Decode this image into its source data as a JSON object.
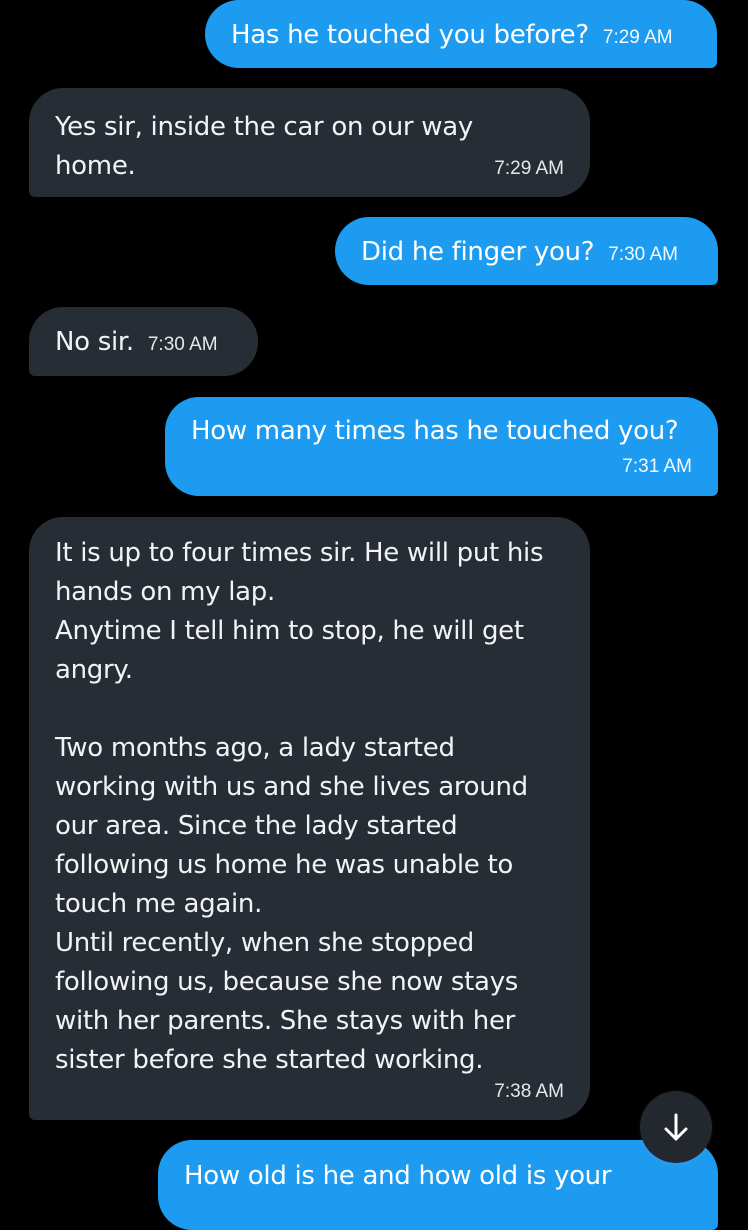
{
  "messages": [
    {
      "side": "sent",
      "text": "Has he touched you before?",
      "time": "7:29 AM"
    },
    {
      "side": "received",
      "lines": [
        "Yes sir, inside the car on our way",
        "home."
      ],
      "time": "7:29 AM"
    },
    {
      "side": "sent",
      "text": "Did he finger you?",
      "time": "7:30 AM"
    },
    {
      "side": "received",
      "text": "No sir.",
      "time": "7:30 AM"
    },
    {
      "side": "sent",
      "text": "How many times has he touched you?",
      "time": "7:31 AM"
    },
    {
      "side": "received",
      "lines": [
        "It is up to four times sir. He will put his",
        "hands on my lap.",
        "Anytime I tell him to stop, he will get",
        "angry.",
        "",
        "Two months ago, a lady started",
        "working with us and she lives around",
        "our area. Since the lady started",
        "following us home he was unable to",
        "touch me again.",
        "Until recently, when she stopped",
        "following us, because she now stays",
        "with her parents. She stays with her",
        "sister before she started working."
      ],
      "time": "7:38 AM"
    },
    {
      "side": "sent",
      "text": "How old is he and how old is your",
      "time": ""
    }
  ],
  "scroll_button": {
    "icon": "arrow-down-icon"
  },
  "colors": {
    "background": "#000000",
    "sent_bubble": "#1d9bf0",
    "received_bubble": "#262d34"
  }
}
